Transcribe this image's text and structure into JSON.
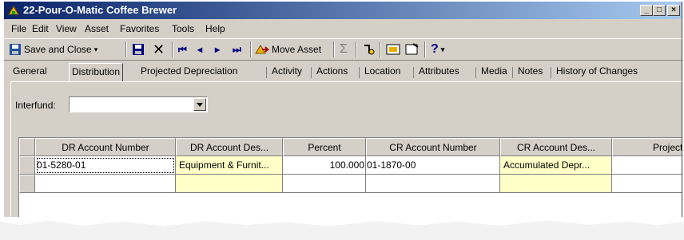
{
  "window": {
    "title": "22-Pour-O-Matic Coffee Brewer",
    "controls": [
      "_",
      "□",
      "×"
    ]
  },
  "menu": [
    "File",
    "Edit",
    "View",
    "Asset",
    "Favorites",
    "Tools",
    "Help"
  ],
  "toolbar": {
    "save_close_label": "Save and Close",
    "move_asset_label": "Move Asset",
    "help_glyph": "?"
  },
  "tabs": [
    {
      "label": "General",
      "active": false
    },
    {
      "label": "Distribution",
      "active": true
    },
    {
      "label": "Projected Depreciation",
      "active": false
    },
    {
      "label": "Activity",
      "active": false
    },
    {
      "label": "Actions",
      "active": false
    },
    {
      "label": "Location",
      "active": false
    },
    {
      "label": "Attributes",
      "active": false
    },
    {
      "label": "Media",
      "active": false
    },
    {
      "label": "Notes",
      "active": false
    },
    {
      "label": "History of Changes",
      "active": false
    }
  ],
  "interfund": {
    "label": "Interfund:",
    "value": ""
  },
  "grid": {
    "columns": [
      "DR Account Number",
      "DR Account Des...",
      "Percent",
      "CR Account Number",
      "CR Account Des...",
      "Project I"
    ],
    "rows": [
      [
        "01-5280-01",
        "Equipment & Furnit...",
        "100.000",
        "01-1870-00",
        "Accumulated Depr...",
        ""
      ],
      [
        "",
        "",
        "",
        "",
        "",
        ""
      ]
    ]
  },
  "colors": {
    "title_start": "#0a246a",
    "title_end": "#a6caf0",
    "highlight": "#ffffc8",
    "chrome": "#d4d0c8"
  }
}
